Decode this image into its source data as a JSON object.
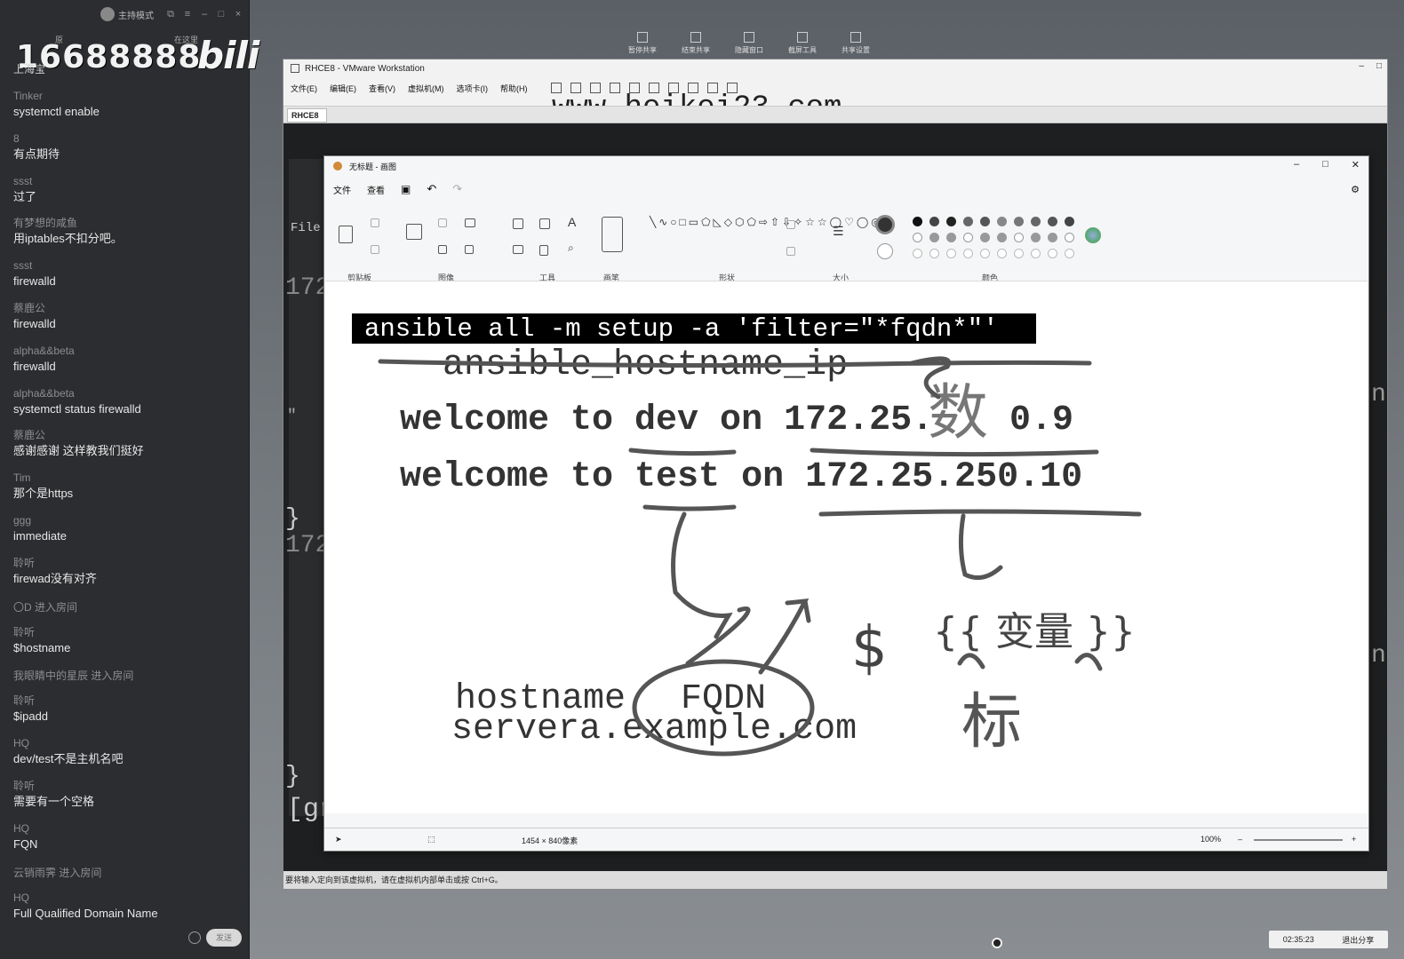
{
  "chat": {
    "host_label": "主持模式",
    "room_number": "16688888",
    "bili_logo": "bili",
    "sub_left": "原",
    "sub_right": "在这里",
    "room_title": "上海宝",
    "messages": [
      {
        "user": "Tinker",
        "text": "systemctl enable"
      },
      {
        "user": "8",
        "text": "有点期待"
      },
      {
        "user": "ssst",
        "text": "过了"
      },
      {
        "user": "有梦想的咸鱼",
        "text": "用iptables不扣分吧。"
      },
      {
        "user": "ssst",
        "text": "firewalld"
      },
      {
        "user": "蔡鹿公",
        "text": "firewalld"
      },
      {
        "user": "alpha&&beta",
        "text": "firewalld"
      },
      {
        "user": "alpha&&beta",
        "text": "systemctl status firewalld"
      },
      {
        "user": "蔡鹿公",
        "text": "感谢感谢  这样教我们挺好"
      },
      {
        "user": "Tim",
        "text": "那个是https"
      },
      {
        "user": "ggg",
        "text": "immediate"
      },
      {
        "user": "聆听",
        "text": "firewad没有对齐"
      },
      {
        "system": "〇D 进入房间"
      },
      {
        "user": "聆听",
        "text": "$hostname"
      },
      {
        "system": "我眼睛中的星辰 进入房间"
      },
      {
        "user": "聆听",
        "text": "$ipadd"
      },
      {
        "user": "HQ",
        "text": "dev/test不是主机名吧"
      },
      {
        "user": "聆听",
        "text": "需要有一个空格"
      },
      {
        "user": "HQ",
        "text": "FQN"
      },
      {
        "system": "云销雨霁 进入房间"
      },
      {
        "user": "HQ",
        "text": "Full Qualified Domain Name"
      }
    ],
    "send_label": "发送"
  },
  "sharebar": [
    "暂停共享",
    "结束共享",
    "隐藏窗口",
    "截屏工具",
    "共享设置"
  ],
  "vmware": {
    "title": "RHCE8 - VMware Workstation",
    "menu": [
      "文件(E)",
      "编辑(E)",
      "查看(V)",
      "虚拟机(M)",
      "选项卡(I)",
      "帮助(H)"
    ],
    "watermark": "www.heikei23.com",
    "tab": "RHCE8",
    "terminal": {
      "file_label": "File",
      "ip_prefix_1": "172",
      "ip_prefix_2": "172",
      "brace_1": "}",
      "brace_2": "}",
      "prompt": "[gr",
      "right_n_1": "n",
      "right_n_2": "n",
      "quote": "\""
    },
    "status": "要将输入定向到该虚拟机，请在虚拟机内部单击或按 Ctrl+G。"
  },
  "paint": {
    "title": "无标题 - 画图",
    "menu": [
      "文件",
      "查看"
    ],
    "groups": [
      "剪贴板",
      "图像",
      "工具",
      "画笔",
      "形状",
      "大小",
      "颜色"
    ],
    "canvas": {
      "command": "ansible all -m setup -a 'filter=\"*fqdn*\"'",
      "line1": "ansible_hostname_ip",
      "line2_a": "welcome to dev on 172.25.",
      "line2_b": "0.9",
      "line3": "welcome to test on 172.25.250.10",
      "hostname_word": "hostname",
      "fqdn_word": "FQDN",
      "servera": "servera.example.com",
      "dollar": "$",
      "var_text": "{{ 变量 }}",
      "handwritten_1": "数",
      "handwritten_2": "标"
    },
    "status_size": "1454 × 840像素",
    "zoom": "100%"
  },
  "clock": {
    "time": "02:35:23",
    "exit_label": "退出分享"
  },
  "colors": {
    "accent": "#2b2d30",
    "paint_bg": "#f5f6f7"
  }
}
